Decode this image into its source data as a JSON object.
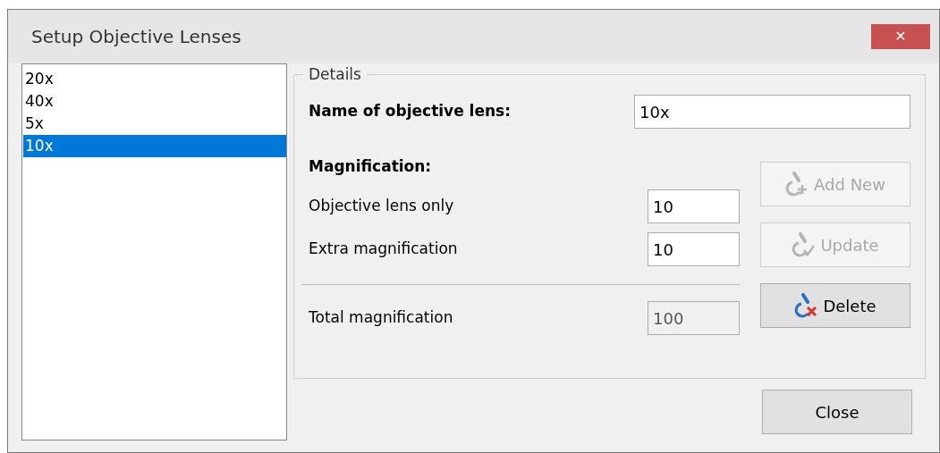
{
  "window": {
    "title": "Setup Objective Lenses",
    "close_label": "✕"
  },
  "lens_list": [
    {
      "label": "20x",
      "selected": false
    },
    {
      "label": "40x",
      "selected": false
    },
    {
      "label": "5x",
      "selected": false
    },
    {
      "label": "10x",
      "selected": true
    }
  ],
  "details": {
    "legend": "Details",
    "name_label": "Name of objective lens:",
    "name_value": "10x",
    "magnification_heading": "Magnification:",
    "fields": [
      {
        "label": "Objective lens only",
        "value": "10",
        "disabled": false
      },
      {
        "label": "Extra magnification",
        "value": "10",
        "disabled": false
      }
    ],
    "total": {
      "label": "Total magnification",
      "value": "100",
      "disabled": true
    },
    "buttons": [
      {
        "kind": "add",
        "label": "Add New",
        "disabled": true
      },
      {
        "kind": "update",
        "label": "Update",
        "disabled": true
      },
      {
        "kind": "delete",
        "label": "Delete",
        "disabled": false
      }
    ]
  },
  "footer_button": "Close"
}
